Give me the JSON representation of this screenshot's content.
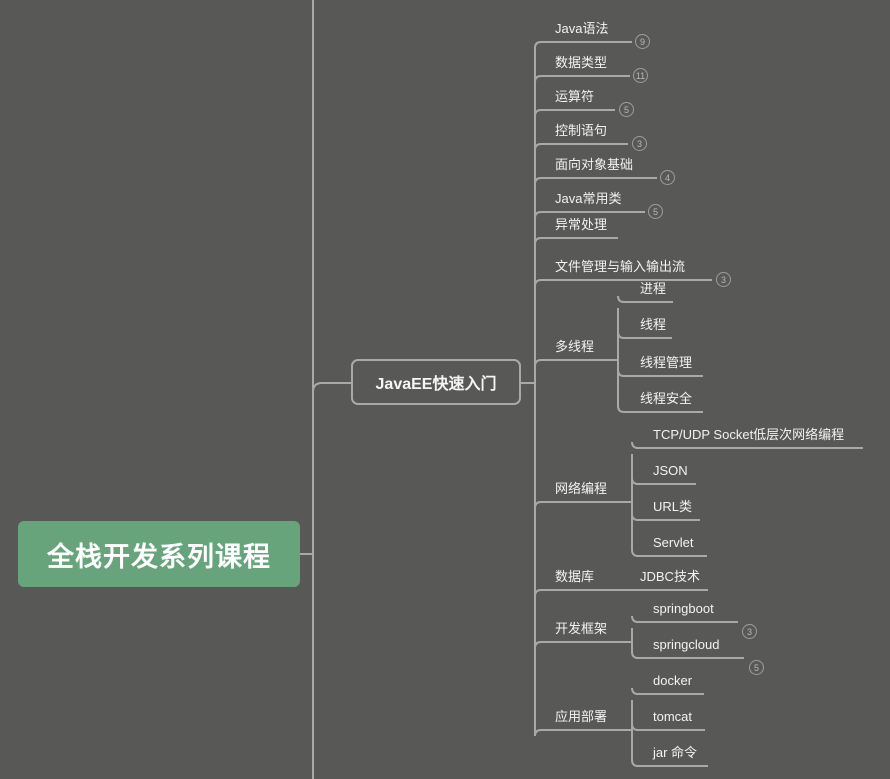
{
  "root": {
    "label": "全栈开发系列课程",
    "color": "#67a47c"
  },
  "main": {
    "label": "JavaEE快速入门"
  },
  "topics": [
    {
      "label": "Java语法",
      "badge": "9"
    },
    {
      "label": "数据类型",
      "badge": "11"
    },
    {
      "label": "运算符",
      "badge": "5"
    },
    {
      "label": "控制语句",
      "badge": "3"
    },
    {
      "label": "面向对象基础",
      "badge": "4"
    },
    {
      "label": "Java常用类",
      "badge": "5"
    },
    {
      "label": "异常处理"
    },
    {
      "label": "文件管理与输入输出流",
      "badge": "3"
    },
    {
      "label": "多线程",
      "children": [
        {
          "label": "进程"
        },
        {
          "label": "线程"
        },
        {
          "label": "线程管理"
        },
        {
          "label": "线程安全"
        }
      ]
    },
    {
      "label": "网络编程",
      "children": [
        {
          "label": "TCP/UDP Socket低层次网络编程"
        },
        {
          "label": "JSON"
        },
        {
          "label": "URL类"
        },
        {
          "label": "Servlet"
        }
      ]
    },
    {
      "label": "数据库",
      "children": [
        {
          "label": "JDBC技术"
        }
      ]
    },
    {
      "label": "开发框架",
      "children": [
        {
          "label": "springboot",
          "badge": "3"
        },
        {
          "label": "springcloud",
          "badge": "5"
        }
      ]
    },
    {
      "label": "应用部署",
      "children": [
        {
          "label": "docker"
        },
        {
          "label": "tomcat"
        },
        {
          "label": "jar 命令"
        }
      ]
    }
  ]
}
